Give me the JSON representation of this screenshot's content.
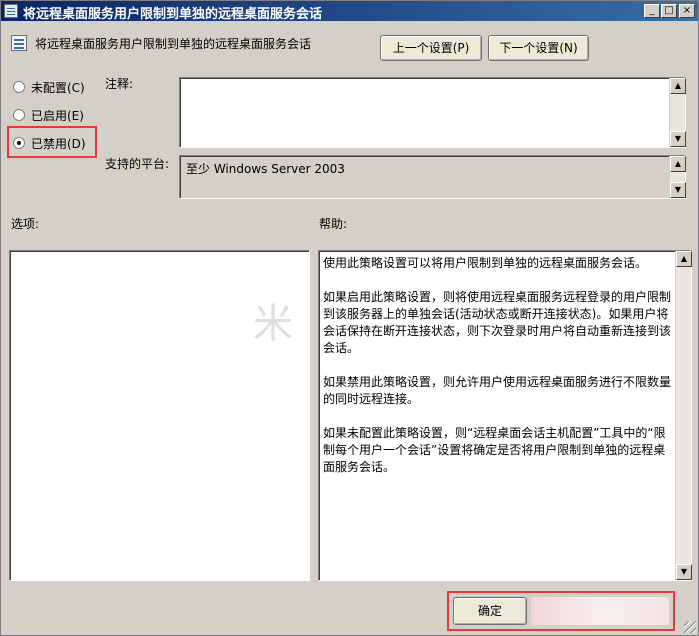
{
  "window": {
    "title": "将远程桌面服务用户限制到单独的远程桌面服务会话",
    "controls": {
      "minimize": "_",
      "maximize": "□",
      "close": "×"
    }
  },
  "header": {
    "policy_name": "将远程桌面服务用户限制到单独的远程桌面服务会话",
    "prev_button": "上一个设置(P)",
    "next_button": "下一个设置(N)"
  },
  "state": {
    "options": [
      {
        "label": "未配置(C)",
        "checked": false
      },
      {
        "label": "已启用(E)",
        "checked": false
      },
      {
        "label": "已禁用(D)",
        "checked": true
      }
    ]
  },
  "comment": {
    "label": "注释:",
    "value": ""
  },
  "platform": {
    "label": "支持的平台:",
    "value": "至少 Windows Server 2003"
  },
  "options_section": {
    "label": "选项:"
  },
  "help_section": {
    "label": "帮助:",
    "paragraphs": [
      "使用此策略设置可以将用户限制到单独的远程桌面服务会话。",
      "如果启用此策略设置，则将使用远程桌面服务远程登录的用户限制到该服务器上的单独会话(活动状态或断开连接状态)。如果用户将会话保持在断开连接状态，则下次登录时用户将自动重新连接到该会话。",
      "如果禁用此策略设置，则允许用户使用远程桌面服务进行不限数量的同时远程连接。",
      "如果未配置此策略设置，则“远程桌面会话主机配置”工具中的“限制每个用户一个会话”设置将确定是否将用户限制到单独的远程桌面服务会话。"
    ]
  },
  "footer": {
    "ok_button": "确定"
  },
  "watermark": "米",
  "colors": {
    "highlight": "#e23b3b",
    "titlebar": "#0a246a"
  }
}
